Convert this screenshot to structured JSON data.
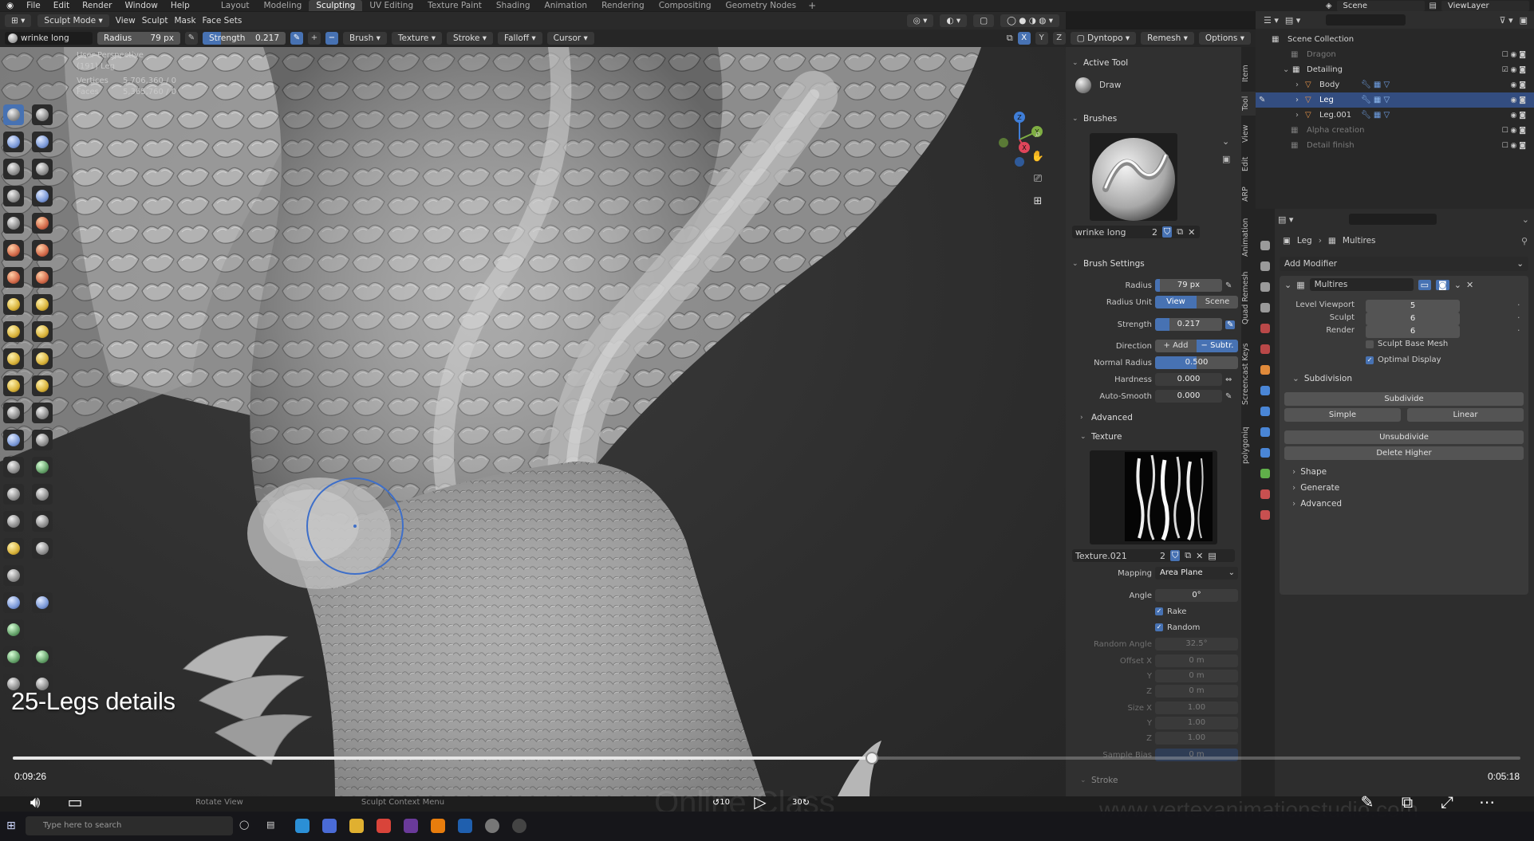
{
  "menubar": {
    "menus": [
      "File",
      "Edit",
      "Render",
      "Window",
      "Help"
    ],
    "workspaces": [
      "Layout",
      "Modeling",
      "Sculpting",
      "UV Editing",
      "Texture Paint",
      "Shading",
      "Animation",
      "Rendering",
      "Compositing",
      "Geometry Nodes"
    ],
    "active_workspace": "Sculpting",
    "scene": "Scene",
    "view_layer": "ViewLayer"
  },
  "viewport_header": {
    "mode": "Sculpt Mode",
    "menus": [
      "View",
      "Sculpt",
      "Mask",
      "Face Sets"
    ]
  },
  "tool_header": {
    "brush_name": "wrinke long",
    "radius_label": "Radius",
    "radius_value": "79 px",
    "strength_label": "Strength",
    "strength_value": "0.217",
    "strength_fraction": 0.217,
    "menus": [
      "Brush",
      "Texture",
      "Stroke",
      "Falloff",
      "Cursor"
    ],
    "axes": [
      "X",
      "Y",
      "Z"
    ],
    "right_menus": [
      "Dyntopo",
      "Remesh",
      "Options"
    ]
  },
  "viewport_info": {
    "perspective": "User Perspective",
    "object": "(191) Leg",
    "vertices_label": "Vertices",
    "vertices_value": "5,706,360 / 0",
    "faces_label": "Faces",
    "faces_value": "5,365,760 / 0"
  },
  "npanel": {
    "active_tool_title": "Active Tool",
    "active_tool": "Draw",
    "brushes_title": "Brushes",
    "brush_name": "wrinke long",
    "brush_users": "2",
    "brush_settings_title": "Brush Settings",
    "radius_label": "Radius",
    "radius_value": "79 px",
    "radius_unit_label": "Radius Unit",
    "radius_unit_view": "View",
    "radius_unit_scene": "Scene",
    "strength_label": "Strength",
    "strength_value": "0.217",
    "direction_label": "Direction",
    "direction_add": "Add",
    "direction_subtract": "Subtr.",
    "normal_radius_label": "Normal Radius",
    "normal_radius_value": "0.500",
    "normal_radius_fraction": 0.5,
    "hardness_label": "Hardness",
    "hardness_value": "0.000",
    "auto_smooth_label": "Auto-Smooth",
    "auto_smooth_value": "0.000",
    "advanced_title": "Advanced",
    "texture_title": "Texture",
    "texture_name": "Texture.021",
    "texture_users": "2",
    "mapping_label": "Mapping",
    "mapping_value": "Area Plane",
    "angle_label": "Angle",
    "angle_value": "0°",
    "rake_label": "Rake",
    "random_label": "Random",
    "random_angle_label": "Random Angle",
    "random_angle_value": "32.5°",
    "offset_x_label": "Offset X",
    "offset_x_value": "0 m",
    "offset_y_label": "Y",
    "offset_y_value": "0 m",
    "offset_z_label": "Z",
    "offset_z_value": "0 m",
    "size_x_label": "Size X",
    "size_x_value": "1.00",
    "size_y_label": "Y",
    "size_y_value": "1.00",
    "size_z_label": "Z",
    "size_z_value": "1.00",
    "sample_bias_label": "Sample Bias",
    "sample_bias_value": "0 m",
    "stroke_title": "Stroke"
  },
  "vertical_tabs": [
    "Item",
    "Tool",
    "View",
    "Edit",
    "ARP",
    "Animation",
    "Quad Remesh",
    "Screencast Keys",
    "polygoniq"
  ],
  "outliner": {
    "root": "Scene Collection",
    "rows": [
      {
        "name": "Dragon",
        "dim": true
      },
      {
        "name": "Detailing",
        "dim": false
      },
      {
        "name": "Body",
        "dim": false
      },
      {
        "name": "Leg",
        "dim": false
      },
      {
        "name": "Leg.001",
        "dim": false
      },
      {
        "name": "Alpha creation",
        "dim": true
      },
      {
        "name": "Detail finish",
        "dim": true
      }
    ]
  },
  "properties": {
    "breadcrumb_object": "Leg",
    "breadcrumb_modifier": "Multires",
    "add_modifier": "Add Modifier",
    "modifier_name": "Multires",
    "level_viewport_label": "Level Viewport",
    "level_viewport_value": "5",
    "sculpt_label": "Sculpt",
    "sculpt_value": "6",
    "render_label": "Render",
    "render_value": "6",
    "sculpt_base_mesh": "Sculpt Base Mesh",
    "optimal_display": "Optimal Display",
    "subdivision_title": "Subdivision",
    "subdivide": "Subdivide",
    "simple": "Simple",
    "linear": "Linear",
    "unsubdivide": "Unsubdivide",
    "delete_higher": "Delete Higher",
    "shape_title": "Shape",
    "generate_title": "Generate",
    "advanced_title": "Advanced"
  },
  "video": {
    "caption": "25-Legs details",
    "elapsed": "0:09:26",
    "remaining": "0:05:18",
    "progress_fraction": 0.57,
    "skip_back": "10",
    "skip_forward": "30",
    "watermark": "www.vertexanimationstudio.com",
    "watermark_center": "Online Class"
  },
  "statusbar": {
    "rotate_view": "Rotate View",
    "context_menu": "Sculpt Context Menu"
  },
  "taskbar": {
    "search_placeholder": "Type here to search"
  },
  "colors": {
    "accent": "#4772b3",
    "selected_row": "#334d80",
    "panel_bg": "#303030"
  }
}
